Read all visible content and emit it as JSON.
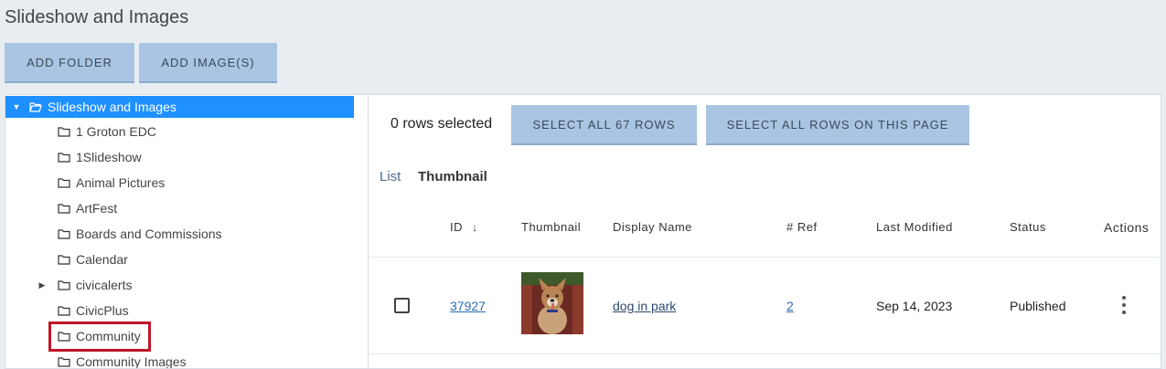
{
  "header": {
    "title": "Slideshow and Images",
    "add_folder": "ADD FOLDER",
    "add_images": "ADD IMAGE(S)"
  },
  "tree": {
    "root": "Slideshow and Images",
    "items": [
      {
        "label": "1 Groton EDC",
        "has_children": false
      },
      {
        "label": "1Slideshow",
        "has_children": false
      },
      {
        "label": "Animal Pictures",
        "has_children": false
      },
      {
        "label": "ArtFest",
        "has_children": false
      },
      {
        "label": "Boards and Commissions",
        "has_children": false
      },
      {
        "label": "Calendar",
        "has_children": false
      },
      {
        "label": "civicalerts",
        "has_children": true
      },
      {
        "label": "CivicPlus",
        "has_children": false
      },
      {
        "label": "Community",
        "has_children": false,
        "highlighted": true
      },
      {
        "label": "Community Images",
        "has_children": false
      }
    ]
  },
  "grid": {
    "rows_selected": "0 rows selected",
    "select_all": "SELECT ALL 67 ROWS",
    "select_page": "SELECT ALL ROWS ON THIS PAGE",
    "tabs": {
      "list": "List",
      "thumbnail": "Thumbnail"
    },
    "columns": {
      "id": "ID",
      "thumbnail": "Thumbnail",
      "display_name": "Display Name",
      "ref": "# Ref",
      "last_modified": "Last Modified",
      "status": "Status",
      "actions": "Actions"
    },
    "sort_icon": "arrow-down-icon",
    "rows": [
      {
        "id": "37927",
        "display_name": "dog in park",
        "ref": "2",
        "last_modified": "Sep 14, 2023",
        "status": "Published"
      }
    ]
  },
  "colors": {
    "button_bg": "#a9c5e3",
    "tree_selected": "#1e90ff",
    "highlight": "#c0142a"
  }
}
